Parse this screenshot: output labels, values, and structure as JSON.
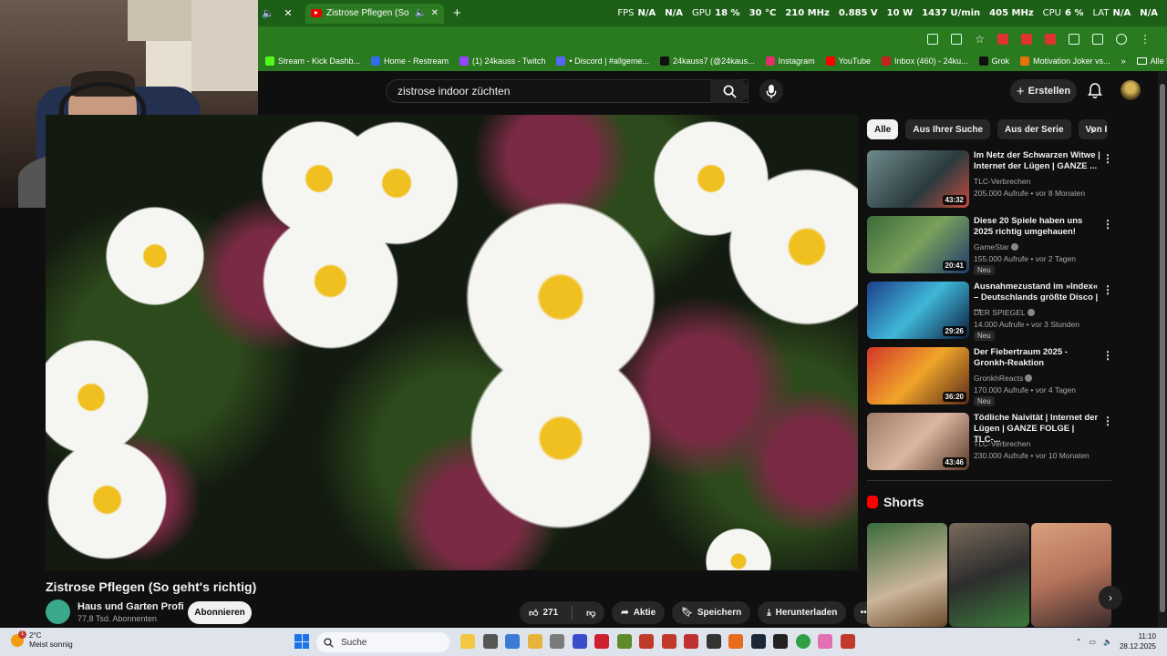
{
  "browser": {
    "tab_title": "Zistrose Pflegen (So geht's",
    "overlay": [
      {
        "label": "FPS",
        "value": "N/A"
      },
      {
        "label": "",
        "value": "N/A"
      },
      {
        "label": "GPU",
        "value": "18 %"
      },
      {
        "label": "",
        "value": "30 °C"
      },
      {
        "label": "",
        "value": "210 MHz"
      },
      {
        "label": "",
        "value": "0.885 V"
      },
      {
        "label": "",
        "value": "10 W"
      },
      {
        "label": "",
        "value": "1437 U/min"
      },
      {
        "label": "",
        "value": "405 MHz"
      },
      {
        "label": "CPU",
        "value": "6 %"
      },
      {
        "label": "LAT",
        "value": "N/A"
      },
      {
        "label": "",
        "value": "N/A"
      }
    ],
    "bookmarks": [
      {
        "label": "Stream - Kick Dashb...",
        "color": "#53fc18"
      },
      {
        "label": "Home - Restream",
        "color": "#2f6ee8"
      },
      {
        "label": "(1) 24kauss - Twitch",
        "color": "#9146ff"
      },
      {
        "label": "• Discord | #allgeme...",
        "color": "#5865f2"
      },
      {
        "label": "24kauss7 (@24kaus...",
        "color": "#111111"
      },
      {
        "label": "Instagram",
        "color": "#e1306c"
      },
      {
        "label": "YouTube",
        "color": "#ff0000"
      },
      {
        "label": "Inbox (460) - 24ku...",
        "color": "#c5221f"
      },
      {
        "label": "Grok",
        "color": "#111111"
      },
      {
        "label": "Motivation Joker vs...",
        "color": "#e8710a"
      }
    ],
    "bookmarks_more": "»",
    "bookmarks_all": "Alle Lesezeichen"
  },
  "header": {
    "search_value": "zistrose indoor züchten",
    "create_label": "Erstellen"
  },
  "video": {
    "title": "Zistrose Pflegen (So geht's richtig)",
    "channel": "Haus und Garten Profi",
    "subscribers": "77,8 Tsd. Abonnenten",
    "subscribe_label": "Abonnieren",
    "likes": "271",
    "share_label": "Aktie",
    "save_label": "Speichern",
    "download_label": "Herunterladen"
  },
  "chips": [
    "Alle",
    "Aus Ihrer Suche",
    "Aus der Serie",
    "Von I"
  ],
  "recommendations": [
    {
      "title": "Im Netz der Schwarzen Witwe | Internet der Lügen | GANZE ...",
      "channel": "TLC-Verbrechen",
      "meta": "205.000 Aufrufe • vor 8 Monaten",
      "duration": "43:32",
      "badge": "",
      "verified": false,
      "thumb": "linear-gradient(135deg,#6f8a8c,#2a3b3f 60%,#c84a3e)"
    },
    {
      "title": "Diese 20 Spiele haben uns 2025 richtig umgehauen!",
      "channel": "GameStar",
      "meta": "155.000 Aufrufe • vor 2 Tagen",
      "duration": "20:41",
      "badge": "Neu",
      "verified": true,
      "thumb": "linear-gradient(135deg,#3c6b3a,#7aa05b 50%,#1f3b6b)"
    },
    {
      "title": "Ausnahmezustand im »Index« – Deutschlands größte Disco | ...",
      "channel": "DER SPIEGEL",
      "meta": "14.000 Aufrufe • vor 3 Stunden",
      "duration": "29:26",
      "badge": "Neu",
      "verified": true,
      "thumb": "linear-gradient(135deg,#1c3f8a,#3fb7d8 50%,#0d1b3a)"
    },
    {
      "title": "Der Fiebertraum 2025 - Gronkh-Reaktion",
      "channel": "GronkhReacts",
      "meta": "170.000 Aufrufe • vor 4 Tagen",
      "duration": "36:20",
      "badge": "Neu",
      "verified": true,
      "thumb": "linear-gradient(135deg,#d1362a,#f0a52a 50%,#5a2a1a)"
    },
    {
      "title": "Tödliche Naivität | Internet der Lügen | GANZE FOLGE | TLC-...",
      "channel": "TLC-Verbrechen",
      "meta": "230.000 Aufrufe • vor 10 Monaten",
      "duration": "43:46",
      "badge": "",
      "verified": false,
      "thumb": "linear-gradient(135deg,#9e7b66,#d9b7a0 50%,#5c3a2c)"
    }
  ],
  "shorts_heading": "Shorts",
  "shorts": [
    {
      "thumb": "linear-gradient(160deg,#3a6a3a,#cbb59a 60%,#6b4a2a)"
    },
    {
      "thumb": "linear-gradient(160deg,#7a6a5a,#2d2d2d 50%,#3b7a3b)"
    },
    {
      "thumb": "linear-gradient(160deg,#d9a07e,#b5735a 50%,#3a2a2a)"
    }
  ],
  "taskbar": {
    "badge": "1",
    "temperature": "2°C",
    "weather": "Meist sonnig",
    "search_placeholder": "Suche",
    "time": "11:10",
    "date": "28.12.2025"
  }
}
